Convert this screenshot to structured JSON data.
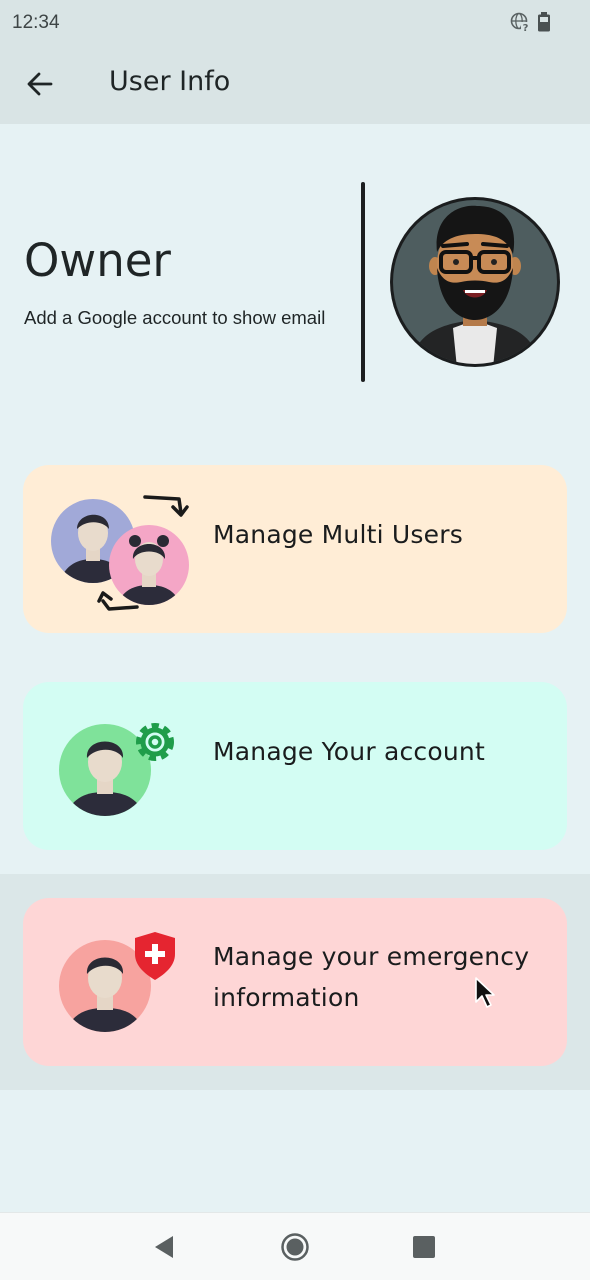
{
  "status_bar": {
    "time": "12:34",
    "icons": [
      "globe-question-icon",
      "battery-icon"
    ]
  },
  "app_bar": {
    "back_icon": "arrow-left-icon",
    "title": "User Info"
  },
  "profile": {
    "name": "Owner",
    "hint": "Add a Google account to show email",
    "avatar_icon": "bearded-man-avatar"
  },
  "cards": [
    {
      "label": "Manage Multi Users",
      "icon": "switch-users-icon",
      "color": "#ffedd6"
    },
    {
      "label": "Manage Your account",
      "icon": "account-settings-icon",
      "color": "#d3fdf3"
    },
    {
      "label": "Manage your emergency information",
      "icon": "emergency-shield-icon",
      "color": "#fed6d6"
    }
  ],
  "nav_bar": {
    "back_icon": "triangle-back-icon",
    "home_icon": "circle-home-icon",
    "recents_icon": "square-recents-icon"
  },
  "colors": {
    "background": "#e6f2f4",
    "app_bar": "#d9e4e5",
    "accent_green": "#1f9d4a",
    "accent_red": "#e52530"
  }
}
